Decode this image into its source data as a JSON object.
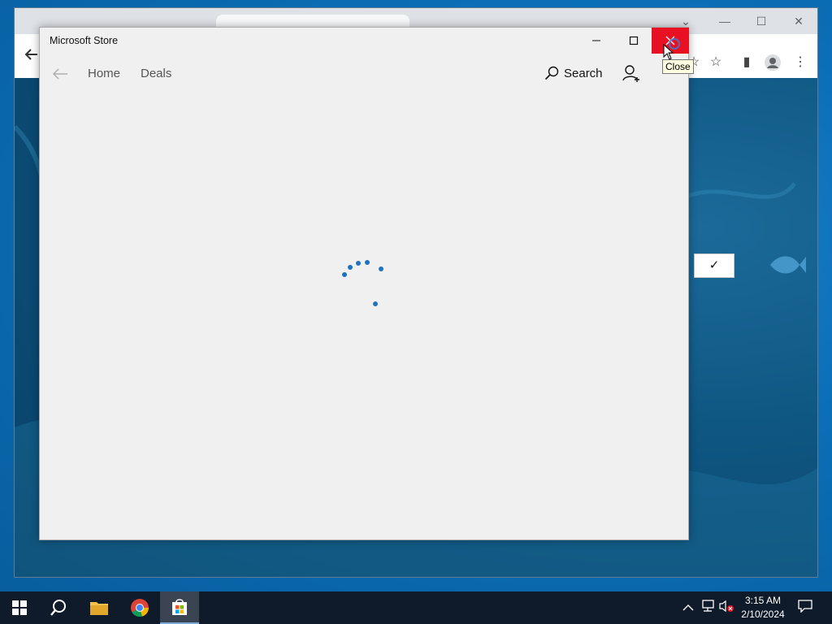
{
  "store_window": {
    "title": "Microsoft Store",
    "nav": {
      "home_label": "Home",
      "deals_label": "Deals",
      "search_label": "Search"
    },
    "close_tooltip": "Close"
  },
  "background_dialog": {
    "confirm_label": "✓"
  },
  "taskbar": {
    "time": "3:15 AM",
    "date": "2/10/2024"
  },
  "colors": {
    "close_red": "#e81123",
    "spinner_blue": "#1e73be",
    "store_bg": "#f0f0f0",
    "taskbar_bg": "#0f1b2a"
  },
  "icons": [
    "back-arrow-icon",
    "search-icon",
    "account-add-icon",
    "minimize-icon",
    "maximize-icon",
    "close-icon",
    "windows-start-icon",
    "search-taskbar-icon",
    "file-explorer-icon",
    "chrome-icon",
    "store-icon",
    "chevron-up-icon",
    "network-icon",
    "volume-muted-icon",
    "notification-icon"
  ]
}
